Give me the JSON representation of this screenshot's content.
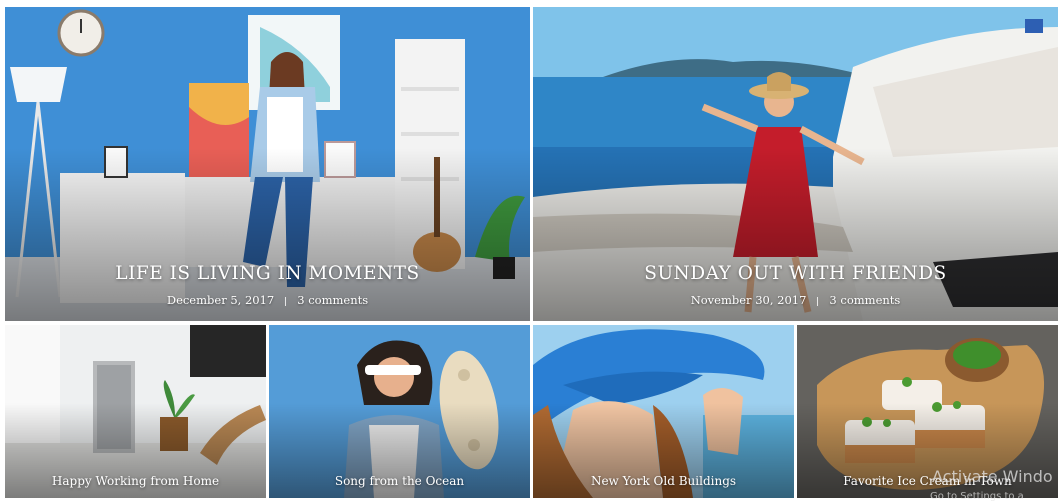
{
  "posts": [
    {
      "title": "LIFE IS LIVING IN MOMENTS",
      "date": "December 5, 2017",
      "comments": "3 comments"
    },
    {
      "title": "SUNDAY OUT WITH FRIENDS",
      "date": "November 30, 2017",
      "comments": "3 comments"
    },
    {
      "title": "Happy Working from Home"
    },
    {
      "title": "Song from the Ocean"
    },
    {
      "title": "New York Old Buildings"
    },
    {
      "title": "Favorite Ice Cream in Town"
    }
  ],
  "watermark": {
    "line1": "Activate Windo",
    "line2": "Go to Settings to a"
  },
  "colors": {
    "wall_blue": "#3f8fd6",
    "sea_blue": "#2f86c7",
    "dress_red": "#c41d2b",
    "hat_blue": "#2a7fd4"
  }
}
